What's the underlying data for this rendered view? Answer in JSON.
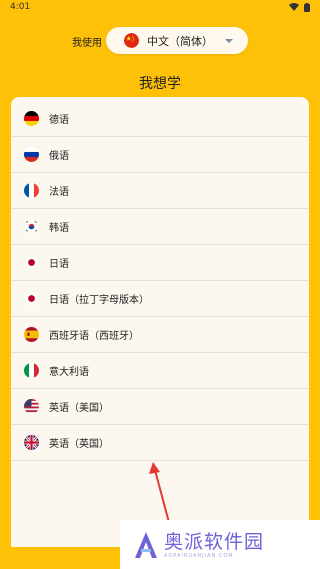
{
  "status_bar": {
    "time": "4:01"
  },
  "language_selector": {
    "label": "我使用",
    "selected": "中文（简体）",
    "selected_flag": "china-flag"
  },
  "page_title": "我想学",
  "languages": [
    {
      "label": "德语",
      "flag": "germany-flag"
    },
    {
      "label": "俄语",
      "flag": "russia-flag"
    },
    {
      "label": "法语",
      "flag": "france-flag"
    },
    {
      "label": "韩语",
      "flag": "korea-flag"
    },
    {
      "label": "日语",
      "flag": "japan-flag"
    },
    {
      "label": "日语（拉丁字母版本）",
      "flag": "japan-flag"
    },
    {
      "label": "西班牙语（西班牙）",
      "flag": "spain-flag"
    },
    {
      "label": "意大利语",
      "flag": "italy-flag"
    },
    {
      "label": "英语（美国）",
      "flag": "usa-flag"
    },
    {
      "label": "英语（英国）",
      "flag": "uk-flag"
    }
  ],
  "watermark": {
    "title": "奥派软件园",
    "subtitle": "AOPAIRUANJIAN.COM"
  },
  "colors": {
    "background": "#FFC107",
    "card": "#FCF8EF",
    "annotation_arrow": "#E53935",
    "watermark_text": "#6E63D6"
  }
}
